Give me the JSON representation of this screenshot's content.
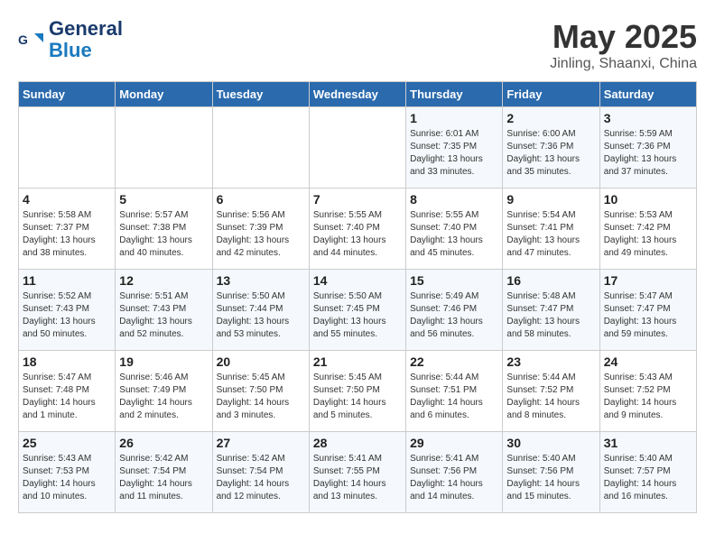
{
  "logo": {
    "line1": "General",
    "line2": "Blue"
  },
  "title": "May 2025",
  "location": "Jinling, Shaanxi, China",
  "weekdays": [
    "Sunday",
    "Monday",
    "Tuesday",
    "Wednesday",
    "Thursday",
    "Friday",
    "Saturday"
  ],
  "weeks": [
    [
      {
        "day": "",
        "info": ""
      },
      {
        "day": "",
        "info": ""
      },
      {
        "day": "",
        "info": ""
      },
      {
        "day": "",
        "info": ""
      },
      {
        "day": "1",
        "info": "Sunrise: 6:01 AM\nSunset: 7:35 PM\nDaylight: 13 hours\nand 33 minutes."
      },
      {
        "day": "2",
        "info": "Sunrise: 6:00 AM\nSunset: 7:36 PM\nDaylight: 13 hours\nand 35 minutes."
      },
      {
        "day": "3",
        "info": "Sunrise: 5:59 AM\nSunset: 7:36 PM\nDaylight: 13 hours\nand 37 minutes."
      }
    ],
    [
      {
        "day": "4",
        "info": "Sunrise: 5:58 AM\nSunset: 7:37 PM\nDaylight: 13 hours\nand 38 minutes."
      },
      {
        "day": "5",
        "info": "Sunrise: 5:57 AM\nSunset: 7:38 PM\nDaylight: 13 hours\nand 40 minutes."
      },
      {
        "day": "6",
        "info": "Sunrise: 5:56 AM\nSunset: 7:39 PM\nDaylight: 13 hours\nand 42 minutes."
      },
      {
        "day": "7",
        "info": "Sunrise: 5:55 AM\nSunset: 7:40 PM\nDaylight: 13 hours\nand 44 minutes."
      },
      {
        "day": "8",
        "info": "Sunrise: 5:55 AM\nSunset: 7:40 PM\nDaylight: 13 hours\nand 45 minutes."
      },
      {
        "day": "9",
        "info": "Sunrise: 5:54 AM\nSunset: 7:41 PM\nDaylight: 13 hours\nand 47 minutes."
      },
      {
        "day": "10",
        "info": "Sunrise: 5:53 AM\nSunset: 7:42 PM\nDaylight: 13 hours\nand 49 minutes."
      }
    ],
    [
      {
        "day": "11",
        "info": "Sunrise: 5:52 AM\nSunset: 7:43 PM\nDaylight: 13 hours\nand 50 minutes."
      },
      {
        "day": "12",
        "info": "Sunrise: 5:51 AM\nSunset: 7:43 PM\nDaylight: 13 hours\nand 52 minutes."
      },
      {
        "day": "13",
        "info": "Sunrise: 5:50 AM\nSunset: 7:44 PM\nDaylight: 13 hours\nand 53 minutes."
      },
      {
        "day": "14",
        "info": "Sunrise: 5:50 AM\nSunset: 7:45 PM\nDaylight: 13 hours\nand 55 minutes."
      },
      {
        "day": "15",
        "info": "Sunrise: 5:49 AM\nSunset: 7:46 PM\nDaylight: 13 hours\nand 56 minutes."
      },
      {
        "day": "16",
        "info": "Sunrise: 5:48 AM\nSunset: 7:47 PM\nDaylight: 13 hours\nand 58 minutes."
      },
      {
        "day": "17",
        "info": "Sunrise: 5:47 AM\nSunset: 7:47 PM\nDaylight: 13 hours\nand 59 minutes."
      }
    ],
    [
      {
        "day": "18",
        "info": "Sunrise: 5:47 AM\nSunset: 7:48 PM\nDaylight: 14 hours\nand 1 minute."
      },
      {
        "day": "19",
        "info": "Sunrise: 5:46 AM\nSunset: 7:49 PM\nDaylight: 14 hours\nand 2 minutes."
      },
      {
        "day": "20",
        "info": "Sunrise: 5:45 AM\nSunset: 7:50 PM\nDaylight: 14 hours\nand 3 minutes."
      },
      {
        "day": "21",
        "info": "Sunrise: 5:45 AM\nSunset: 7:50 PM\nDaylight: 14 hours\nand 5 minutes."
      },
      {
        "day": "22",
        "info": "Sunrise: 5:44 AM\nSunset: 7:51 PM\nDaylight: 14 hours\nand 6 minutes."
      },
      {
        "day": "23",
        "info": "Sunrise: 5:44 AM\nSunset: 7:52 PM\nDaylight: 14 hours\nand 8 minutes."
      },
      {
        "day": "24",
        "info": "Sunrise: 5:43 AM\nSunset: 7:52 PM\nDaylight: 14 hours\nand 9 minutes."
      }
    ],
    [
      {
        "day": "25",
        "info": "Sunrise: 5:43 AM\nSunset: 7:53 PM\nDaylight: 14 hours\nand 10 minutes."
      },
      {
        "day": "26",
        "info": "Sunrise: 5:42 AM\nSunset: 7:54 PM\nDaylight: 14 hours\nand 11 minutes."
      },
      {
        "day": "27",
        "info": "Sunrise: 5:42 AM\nSunset: 7:54 PM\nDaylight: 14 hours\nand 12 minutes."
      },
      {
        "day": "28",
        "info": "Sunrise: 5:41 AM\nSunset: 7:55 PM\nDaylight: 14 hours\nand 13 minutes."
      },
      {
        "day": "29",
        "info": "Sunrise: 5:41 AM\nSunset: 7:56 PM\nDaylight: 14 hours\nand 14 minutes."
      },
      {
        "day": "30",
        "info": "Sunrise: 5:40 AM\nSunset: 7:56 PM\nDaylight: 14 hours\nand 15 minutes."
      },
      {
        "day": "31",
        "info": "Sunrise: 5:40 AM\nSunset: 7:57 PM\nDaylight: 14 hours\nand 16 minutes."
      }
    ]
  ]
}
